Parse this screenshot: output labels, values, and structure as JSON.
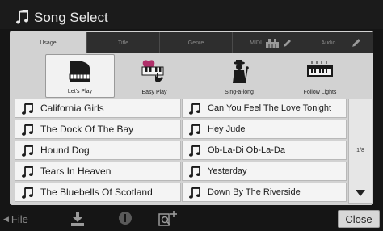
{
  "window": {
    "title": "Song Select",
    "title_icon": "music-note-icon"
  },
  "tabs": [
    {
      "label": "Usage",
      "active": true
    },
    {
      "label": "Title",
      "active": false
    },
    {
      "label": "Genre",
      "active": false
    },
    {
      "label": "MIDI",
      "active": false,
      "icons": [
        "keyboard-icon",
        "pencil-icon"
      ]
    },
    {
      "label": "Audio",
      "active": false,
      "icons": [
        "pencil-icon"
      ]
    }
  ],
  "categories": [
    {
      "label": "Let's Play",
      "icon": "grand-piano-icon",
      "active": true
    },
    {
      "label": "Easy Play",
      "icon": "heart-keyboard-icon",
      "active": false
    },
    {
      "label": "Sing-a-long",
      "icon": "singer-icon",
      "active": false
    },
    {
      "label": "Follow Lights",
      "icon": "keyboard-lights-icon",
      "active": false
    }
  ],
  "songs": {
    "left": [
      "California Girls",
      "The Dock Of The Bay",
      "Hound Dog",
      "Tears In Heaven",
      "The Bluebells Of Scotland"
    ],
    "right": [
      "Can You Feel The Love Tonight",
      "Hey Jude",
      "Ob-La-Di Ob-La-Da",
      "Yesterday",
      "Down By The Riverside"
    ]
  },
  "pagination": {
    "indicator": "1/8"
  },
  "bottom": {
    "file_label": "File",
    "close_label": "Close"
  },
  "colors": {
    "background": "#151515",
    "panel": "#d2d2d2",
    "list_item": "#f4f4f4",
    "text_light": "#e8e8e8"
  }
}
